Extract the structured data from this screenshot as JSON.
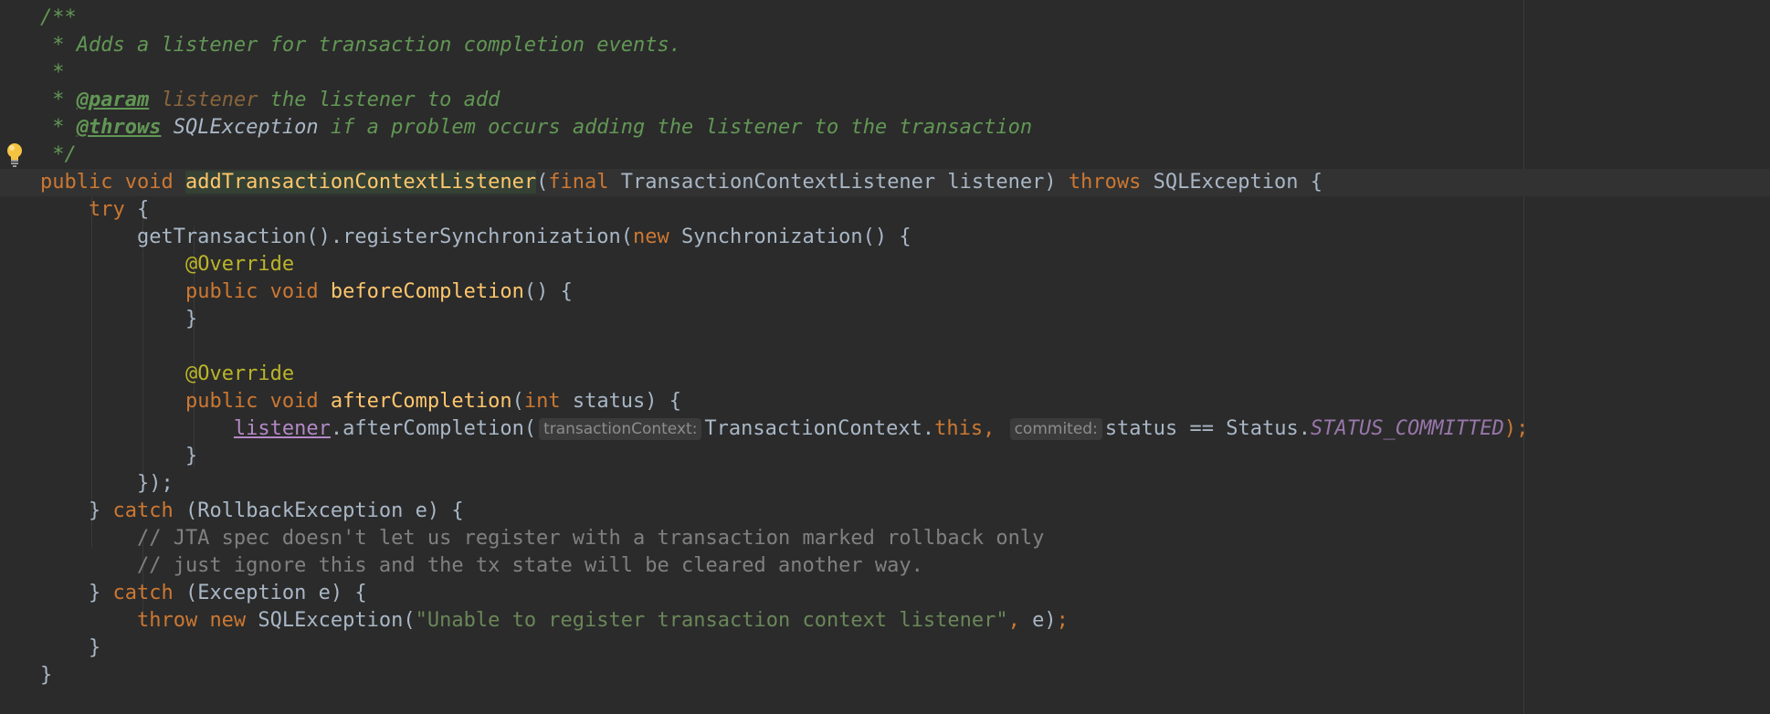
{
  "gutter": {
    "intention_icon": "lightbulb-icon"
  },
  "code": {
    "lines": [
      [
        {
          "t": "/**",
          "c": "doc"
        }
      ],
      [
        {
          "t": " * Adds a listener for transaction completion events.",
          "c": "doc"
        }
      ],
      [
        {
          "t": " *",
          "c": "doc"
        }
      ],
      [
        {
          "t": " * ",
          "c": "doc"
        },
        {
          "t": "@param",
          "c": "doctag"
        },
        {
          "t": " ",
          "c": "doc"
        },
        {
          "t": "listener",
          "c": "docval"
        },
        {
          "t": " the listener to add",
          "c": "doc"
        }
      ],
      [
        {
          "t": " * ",
          "c": "doc"
        },
        {
          "t": "@throws",
          "c": "doctag"
        },
        {
          "t": " ",
          "c": "doc"
        },
        {
          "t": "SQLException",
          "c": "docref"
        },
        {
          "t": " if a problem occurs adding the listener to the transaction",
          "c": "doc"
        }
      ],
      [
        {
          "t": " */",
          "c": "doc"
        }
      ],
      [
        {
          "t": "public void ",
          "c": "kw"
        },
        {
          "t": "addTransactionContextListener",
          "c": "fn-hl"
        },
        {
          "t": "(",
          "c": ""
        },
        {
          "t": "final ",
          "c": "kw"
        },
        {
          "t": "TransactionContextListener listener) ",
          "c": ""
        },
        {
          "t": "throws ",
          "c": "kw"
        },
        {
          "t": "SQLException {",
          "c": ""
        }
      ],
      [
        {
          "t": "    ",
          "c": ""
        },
        {
          "t": "try ",
          "c": "kw"
        },
        {
          "t": "{",
          "c": ""
        }
      ],
      [
        {
          "t": "        getTransaction().registerSynchronization(",
          "c": ""
        },
        {
          "t": "new ",
          "c": "kw"
        },
        {
          "t": "Synchronization() {",
          "c": ""
        }
      ],
      [
        {
          "t": "            ",
          "c": ""
        },
        {
          "t": "@Override",
          "c": "ann"
        }
      ],
      [
        {
          "t": "            ",
          "c": ""
        },
        {
          "t": "public void ",
          "c": "kw"
        },
        {
          "t": "beforeCompletion",
          "c": "fn"
        },
        {
          "t": "() {",
          "c": ""
        }
      ],
      [
        {
          "t": "            }",
          "c": ""
        }
      ],
      [
        {
          "t": "",
          "c": ""
        }
      ],
      [
        {
          "t": "            ",
          "c": ""
        },
        {
          "t": "@Override",
          "c": "ann"
        }
      ],
      [
        {
          "t": "            ",
          "c": ""
        },
        {
          "t": "public void ",
          "c": "kw"
        },
        {
          "t": "afterCompletion",
          "c": "fn"
        },
        {
          "t": "(",
          "c": ""
        },
        {
          "t": "int ",
          "c": "kw"
        },
        {
          "t": "status) {",
          "c": ""
        }
      ],
      [
        {
          "t": "                ",
          "c": ""
        },
        {
          "t": "listener",
          "c": "param-link"
        },
        {
          "t": ".afterCompletion(",
          "c": ""
        },
        {
          "t": "transactionContext:",
          "c": "hint"
        },
        {
          "t": "TransactionContext.",
          "c": ""
        },
        {
          "t": "this",
          "c": "kw"
        },
        {
          "t": ", ",
          "c": "kw"
        },
        {
          "t": "commited:",
          "c": "hint"
        },
        {
          "t": "status == Status.",
          "c": ""
        },
        {
          "t": "STATUS_COMMITTED",
          "c": "field"
        },
        {
          "t": ");",
          "c": "kw"
        }
      ],
      [
        {
          "t": "            }",
          "c": ""
        }
      ],
      [
        {
          "t": "        });",
          "c": ""
        }
      ],
      [
        {
          "t": "    } ",
          "c": ""
        },
        {
          "t": "catch ",
          "c": "kw"
        },
        {
          "t": "(RollbackException e) {",
          "c": ""
        }
      ],
      [
        {
          "t": "        // JTA spec doesn't let us register with a transaction marked rollback only",
          "c": "cmt"
        }
      ],
      [
        {
          "t": "        // just ignore this and the tx state will be cleared another way.",
          "c": "cmt"
        }
      ],
      [
        {
          "t": "    } ",
          "c": ""
        },
        {
          "t": "catch ",
          "c": "kw"
        },
        {
          "t": "(Exception e) {",
          "c": ""
        }
      ],
      [
        {
          "t": "        ",
          "c": ""
        },
        {
          "t": "throw new ",
          "c": "kw"
        },
        {
          "t": "SQLException(",
          "c": ""
        },
        {
          "t": "\"Unable to register transaction context listener\"",
          "c": "str"
        },
        {
          "t": ", ",
          "c": "kw"
        },
        {
          "t": "e)",
          "c": ""
        },
        {
          "t": ";",
          "c": "kw"
        }
      ],
      [
        {
          "t": "    }",
          "c": ""
        }
      ],
      [
        {
          "t": "}",
          "c": ""
        }
      ]
    ]
  }
}
